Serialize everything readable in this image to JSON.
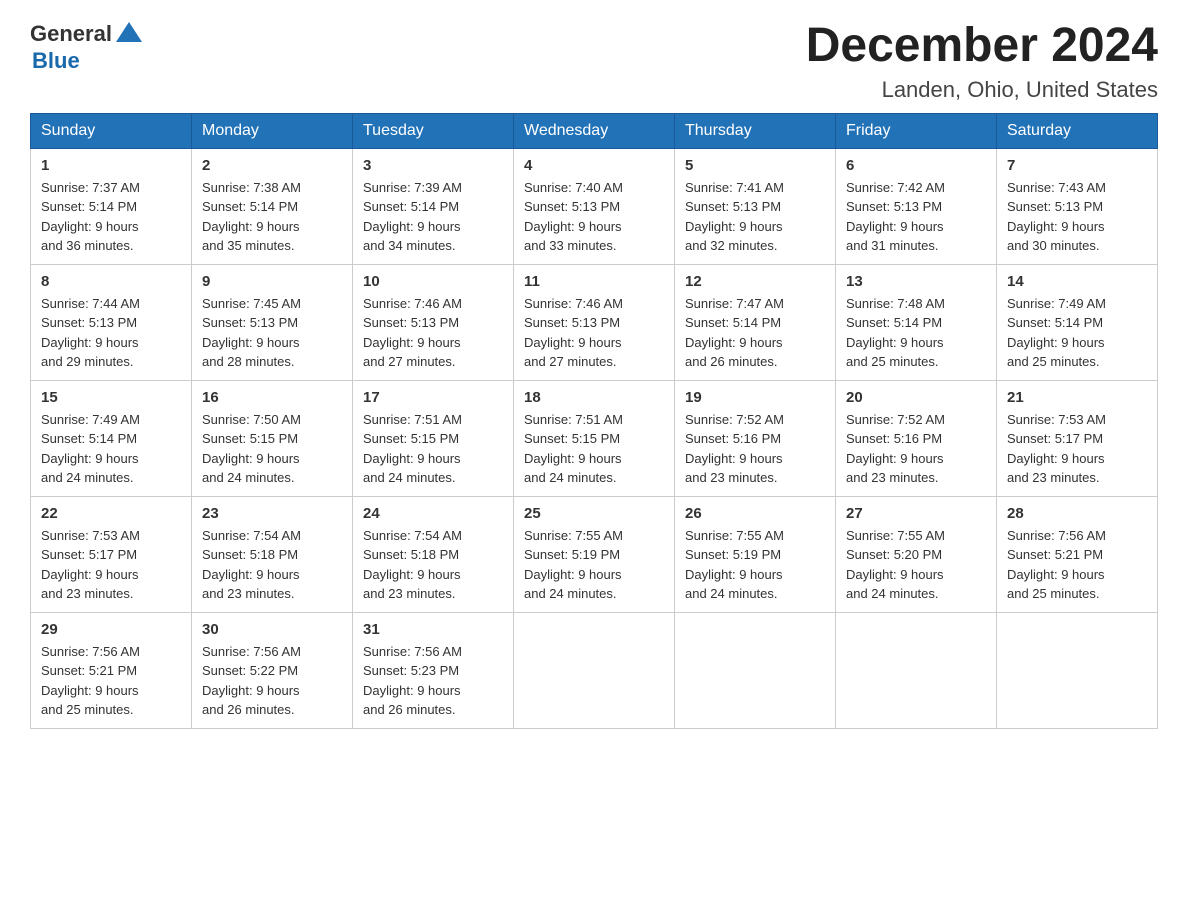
{
  "logo": {
    "general": "General",
    "blue": "Blue"
  },
  "title": "December 2024",
  "subtitle": "Landen, Ohio, United States",
  "days_of_week": [
    "Sunday",
    "Monday",
    "Tuesday",
    "Wednesday",
    "Thursday",
    "Friday",
    "Saturday"
  ],
  "weeks": [
    [
      {
        "day": "1",
        "sunrise": "7:37 AM",
        "sunset": "5:14 PM",
        "daylight": "9 hours and 36 minutes."
      },
      {
        "day": "2",
        "sunrise": "7:38 AM",
        "sunset": "5:14 PM",
        "daylight": "9 hours and 35 minutes."
      },
      {
        "day": "3",
        "sunrise": "7:39 AM",
        "sunset": "5:14 PM",
        "daylight": "9 hours and 34 minutes."
      },
      {
        "day": "4",
        "sunrise": "7:40 AM",
        "sunset": "5:13 PM",
        "daylight": "9 hours and 33 minutes."
      },
      {
        "day": "5",
        "sunrise": "7:41 AM",
        "sunset": "5:13 PM",
        "daylight": "9 hours and 32 minutes."
      },
      {
        "day": "6",
        "sunrise": "7:42 AM",
        "sunset": "5:13 PM",
        "daylight": "9 hours and 31 minutes."
      },
      {
        "day": "7",
        "sunrise": "7:43 AM",
        "sunset": "5:13 PM",
        "daylight": "9 hours and 30 minutes."
      }
    ],
    [
      {
        "day": "8",
        "sunrise": "7:44 AM",
        "sunset": "5:13 PM",
        "daylight": "9 hours and 29 minutes."
      },
      {
        "day": "9",
        "sunrise": "7:45 AM",
        "sunset": "5:13 PM",
        "daylight": "9 hours and 28 minutes."
      },
      {
        "day": "10",
        "sunrise": "7:46 AM",
        "sunset": "5:13 PM",
        "daylight": "9 hours and 27 minutes."
      },
      {
        "day": "11",
        "sunrise": "7:46 AM",
        "sunset": "5:13 PM",
        "daylight": "9 hours and 27 minutes."
      },
      {
        "day": "12",
        "sunrise": "7:47 AM",
        "sunset": "5:14 PM",
        "daylight": "9 hours and 26 minutes."
      },
      {
        "day": "13",
        "sunrise": "7:48 AM",
        "sunset": "5:14 PM",
        "daylight": "9 hours and 25 minutes."
      },
      {
        "day": "14",
        "sunrise": "7:49 AM",
        "sunset": "5:14 PM",
        "daylight": "9 hours and 25 minutes."
      }
    ],
    [
      {
        "day": "15",
        "sunrise": "7:49 AM",
        "sunset": "5:14 PM",
        "daylight": "9 hours and 24 minutes."
      },
      {
        "day": "16",
        "sunrise": "7:50 AM",
        "sunset": "5:15 PM",
        "daylight": "9 hours and 24 minutes."
      },
      {
        "day": "17",
        "sunrise": "7:51 AM",
        "sunset": "5:15 PM",
        "daylight": "9 hours and 24 minutes."
      },
      {
        "day": "18",
        "sunrise": "7:51 AM",
        "sunset": "5:15 PM",
        "daylight": "9 hours and 24 minutes."
      },
      {
        "day": "19",
        "sunrise": "7:52 AM",
        "sunset": "5:16 PM",
        "daylight": "9 hours and 23 minutes."
      },
      {
        "day": "20",
        "sunrise": "7:52 AM",
        "sunset": "5:16 PM",
        "daylight": "9 hours and 23 minutes."
      },
      {
        "day": "21",
        "sunrise": "7:53 AM",
        "sunset": "5:17 PM",
        "daylight": "9 hours and 23 minutes."
      }
    ],
    [
      {
        "day": "22",
        "sunrise": "7:53 AM",
        "sunset": "5:17 PM",
        "daylight": "9 hours and 23 minutes."
      },
      {
        "day": "23",
        "sunrise": "7:54 AM",
        "sunset": "5:18 PM",
        "daylight": "9 hours and 23 minutes."
      },
      {
        "day": "24",
        "sunrise": "7:54 AM",
        "sunset": "5:18 PM",
        "daylight": "9 hours and 23 minutes."
      },
      {
        "day": "25",
        "sunrise": "7:55 AM",
        "sunset": "5:19 PM",
        "daylight": "9 hours and 24 minutes."
      },
      {
        "day": "26",
        "sunrise": "7:55 AM",
        "sunset": "5:19 PM",
        "daylight": "9 hours and 24 minutes."
      },
      {
        "day": "27",
        "sunrise": "7:55 AM",
        "sunset": "5:20 PM",
        "daylight": "9 hours and 24 minutes."
      },
      {
        "day": "28",
        "sunrise": "7:56 AM",
        "sunset": "5:21 PM",
        "daylight": "9 hours and 25 minutes."
      }
    ],
    [
      {
        "day": "29",
        "sunrise": "7:56 AM",
        "sunset": "5:21 PM",
        "daylight": "9 hours and 25 minutes."
      },
      {
        "day": "30",
        "sunrise": "7:56 AM",
        "sunset": "5:22 PM",
        "daylight": "9 hours and 26 minutes."
      },
      {
        "day": "31",
        "sunrise": "7:56 AM",
        "sunset": "5:23 PM",
        "daylight": "9 hours and 26 minutes."
      },
      null,
      null,
      null,
      null
    ]
  ],
  "labels": {
    "sunrise": "Sunrise:",
    "sunset": "Sunset:",
    "daylight": "Daylight:"
  }
}
